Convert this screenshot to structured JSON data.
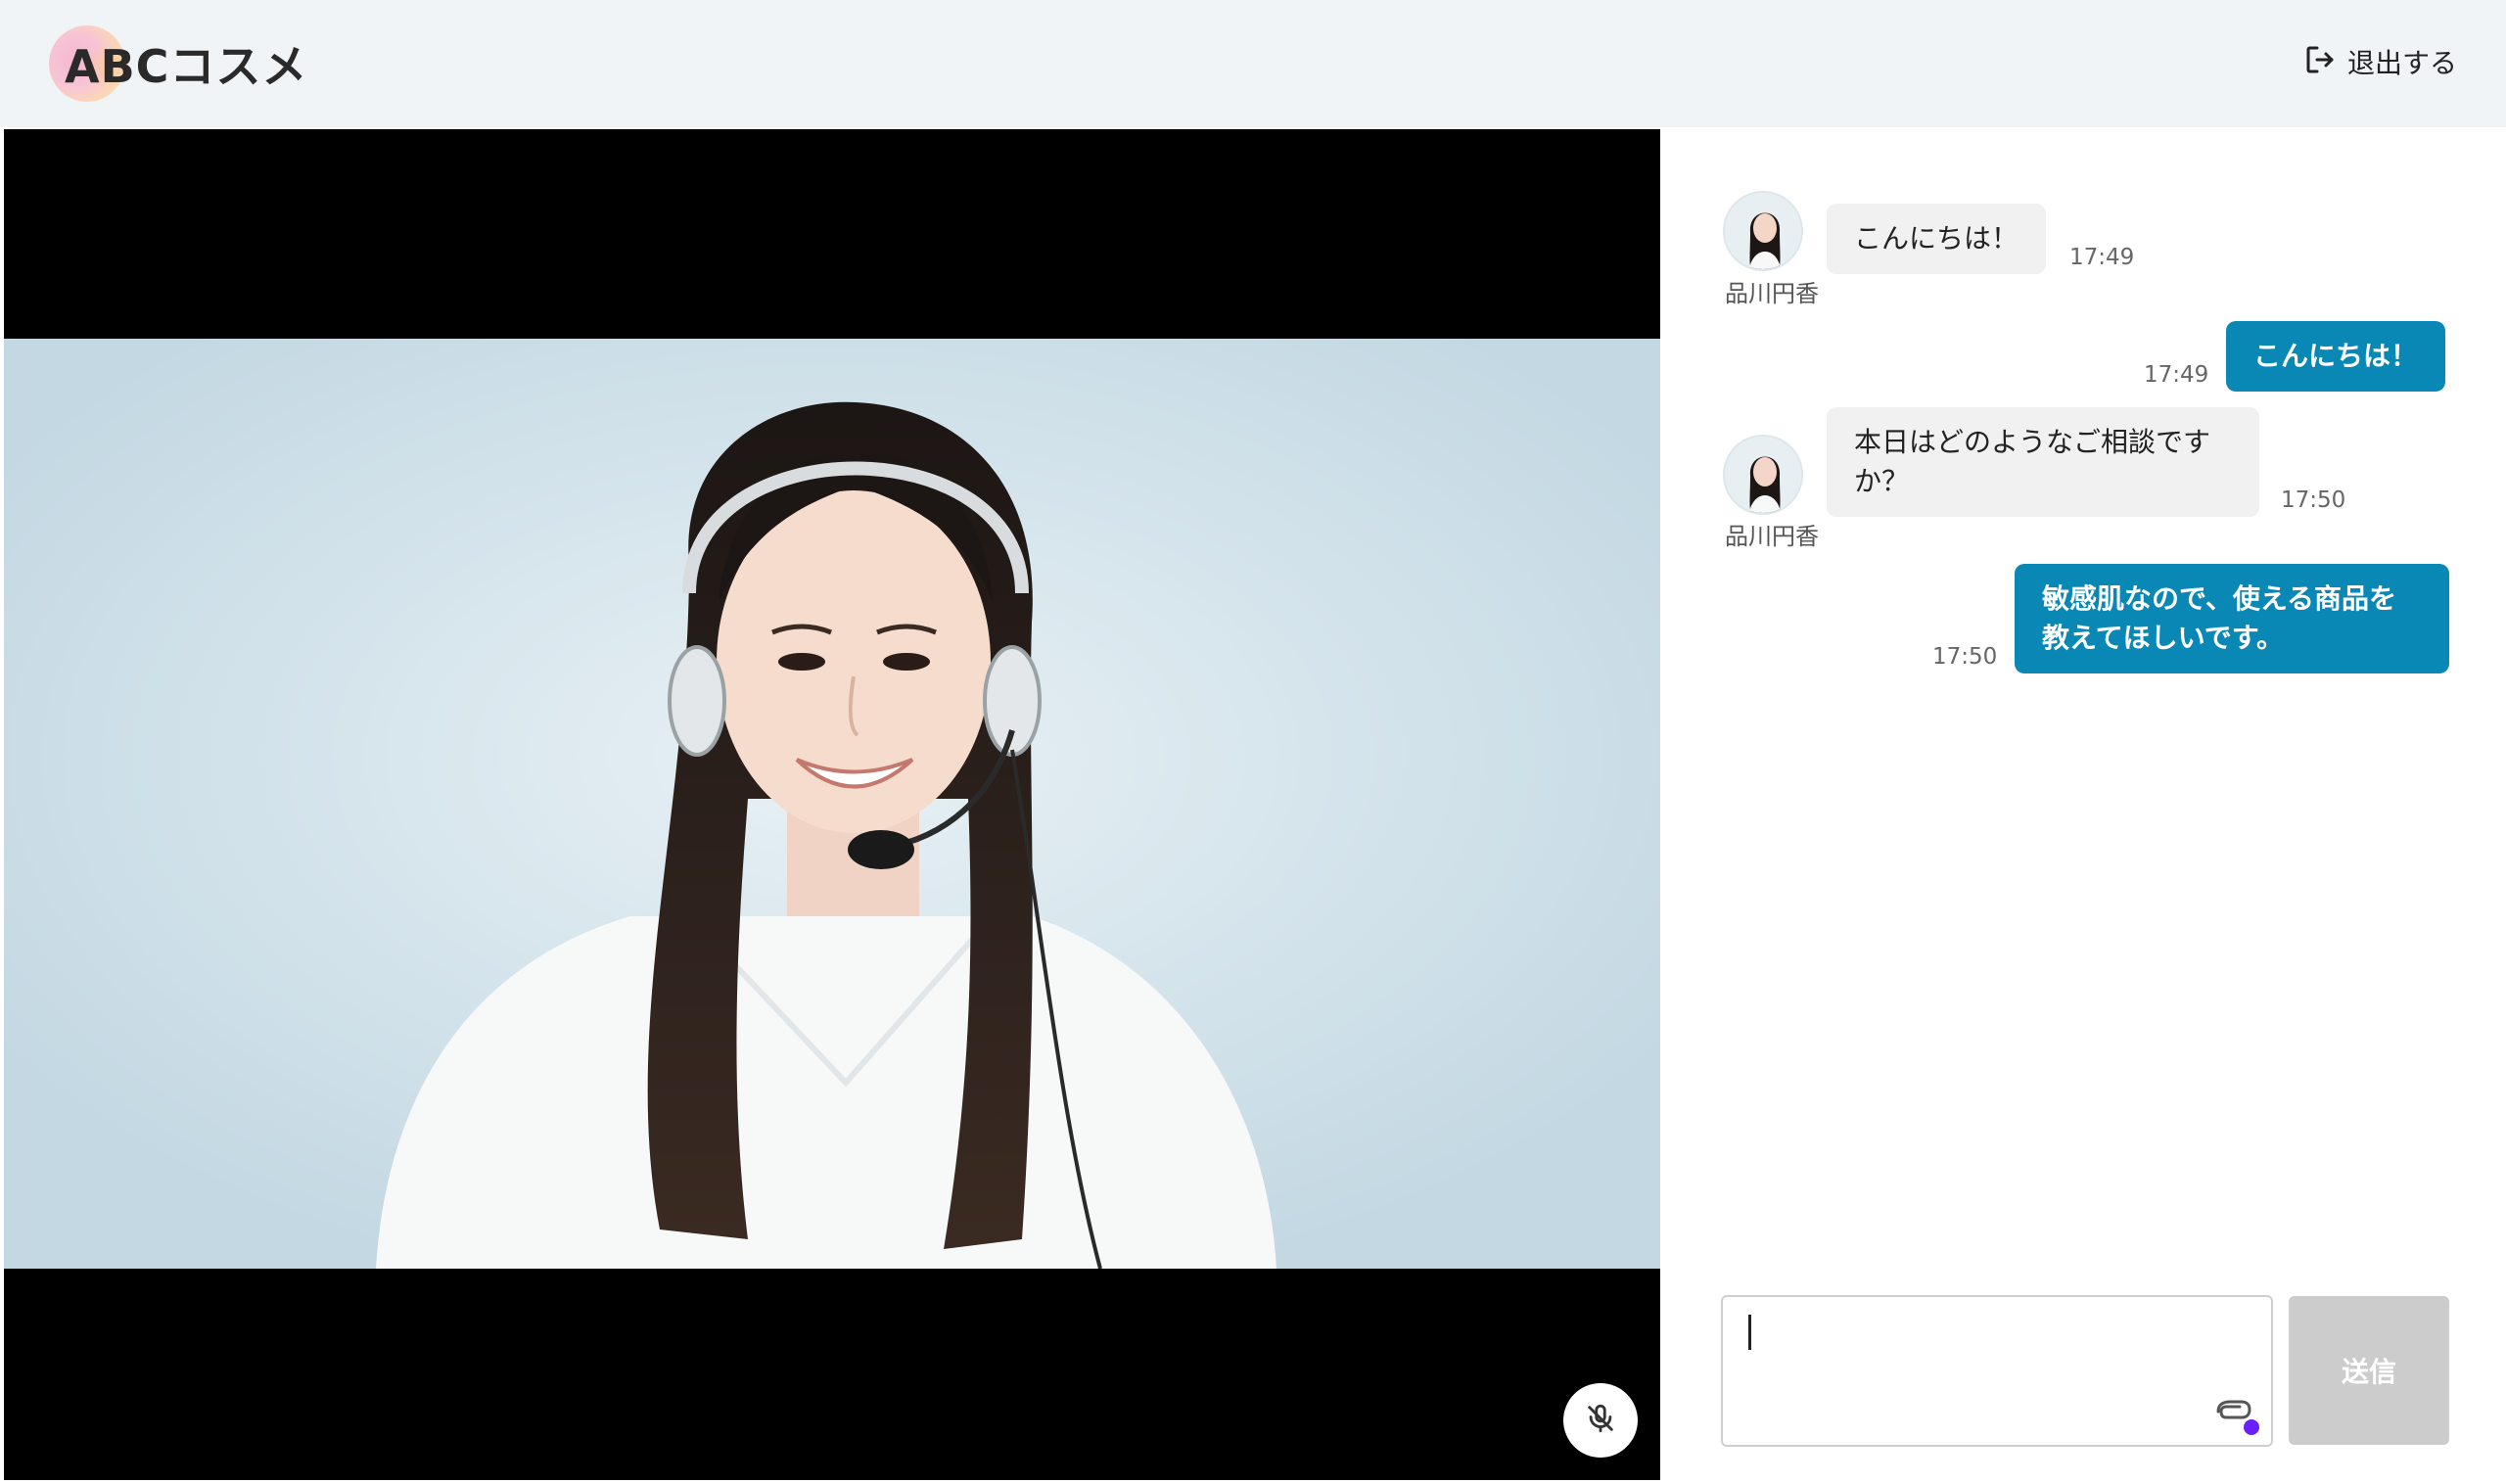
{
  "header": {
    "logo_text": "ABCコスメ",
    "logout_label": "退出する"
  },
  "video": {
    "mute_icon": "mic-off-icon"
  },
  "chat": {
    "messages": [
      {
        "direction": "in",
        "sender": "品川円香",
        "text": "こんにちは！",
        "time": "17:49"
      },
      {
        "direction": "out",
        "text": "こんにちは！",
        "time": "17:49"
      },
      {
        "direction": "in",
        "sender": "品川円香",
        "text": "本日はどのようなご相談ですか？",
        "time": "17:50"
      },
      {
        "direction": "out",
        "text": "敏感肌なので、使える商品を教えてほしいです。",
        "time": "17:50"
      }
    ],
    "input": {
      "value": "",
      "placeholder": ""
    },
    "send_label": "送信"
  },
  "colors": {
    "header_bg": "#f0f4f7",
    "outgoing_bubble": "#0a88b5",
    "incoming_bubble": "#f1f1f1",
    "send_disabled": "#cccccc",
    "attach_indicator": "#6a1fff"
  }
}
